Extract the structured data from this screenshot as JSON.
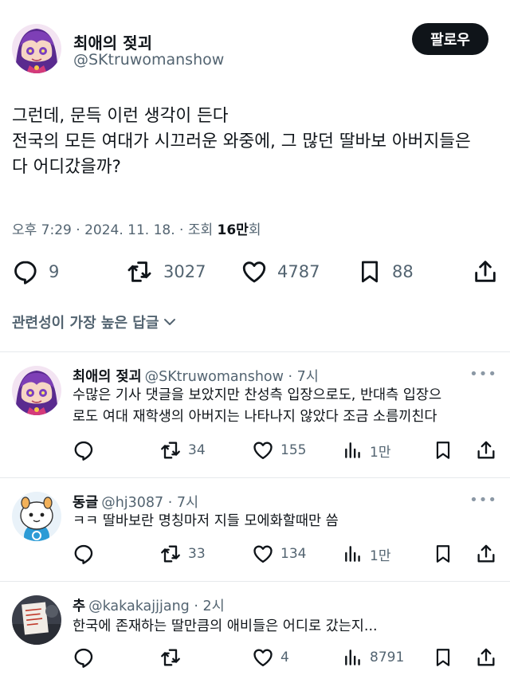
{
  "post": {
    "author_name": "최애의 젖괴",
    "author_handle": "@SKtruwomanshow",
    "follow_label": "팔로우",
    "text_lines": [
      "그런데, 문득 이런 생각이 든다",
      "전국의 모든 여대가 시끄러운 와중에, 그 많던 딸바보 아버지들은",
      "다 어디갔을까?"
    ],
    "meta_prefix": "오후 7:29 · 2024. 11. 18. · 조회 ",
    "meta_views": "16만",
    "meta_suffix": "회",
    "replies_count": "9",
    "reposts_count": "3027",
    "likes_count": "4787",
    "bookmarks_count": "88"
  },
  "sort": {
    "label": "관련성이 가장 높은 답글"
  },
  "replies": [
    {
      "name": "최애의 젖괴",
      "handle_time": "@SKtruwomanshow · 7시",
      "lines": [
        "수많은 기사 댓글을 보았지만 찬성측 입장으로도, 반대측 입장으",
        "로도 여대 재학생의 아버지는 나타나지 않았다 조금 소름끼친다"
      ],
      "reposts": "34",
      "likes": "155",
      "views": "1만"
    },
    {
      "name": "동글",
      "handle_time": "@hj3087 · 7시",
      "lines": [
        "ㅋㅋ 딸바보란 명칭마저 지들 모에화할때만 씀"
      ],
      "reposts": "33",
      "likes": "134",
      "views": "1만"
    },
    {
      "name": "추",
      "handle_time": "@kakakajjjang · 2시",
      "lines": [
        "한국에 존재하는 딸만큼의 애비들은 어디로 갔는지..."
      ],
      "reposts": "",
      "likes": "4",
      "views": "8791"
    }
  ],
  "more_icon": "•••",
  "colors": {
    "text": "#0f1419",
    "secondary": "#536471",
    "divider": "#e6e9ec",
    "button": "#0f1419"
  }
}
